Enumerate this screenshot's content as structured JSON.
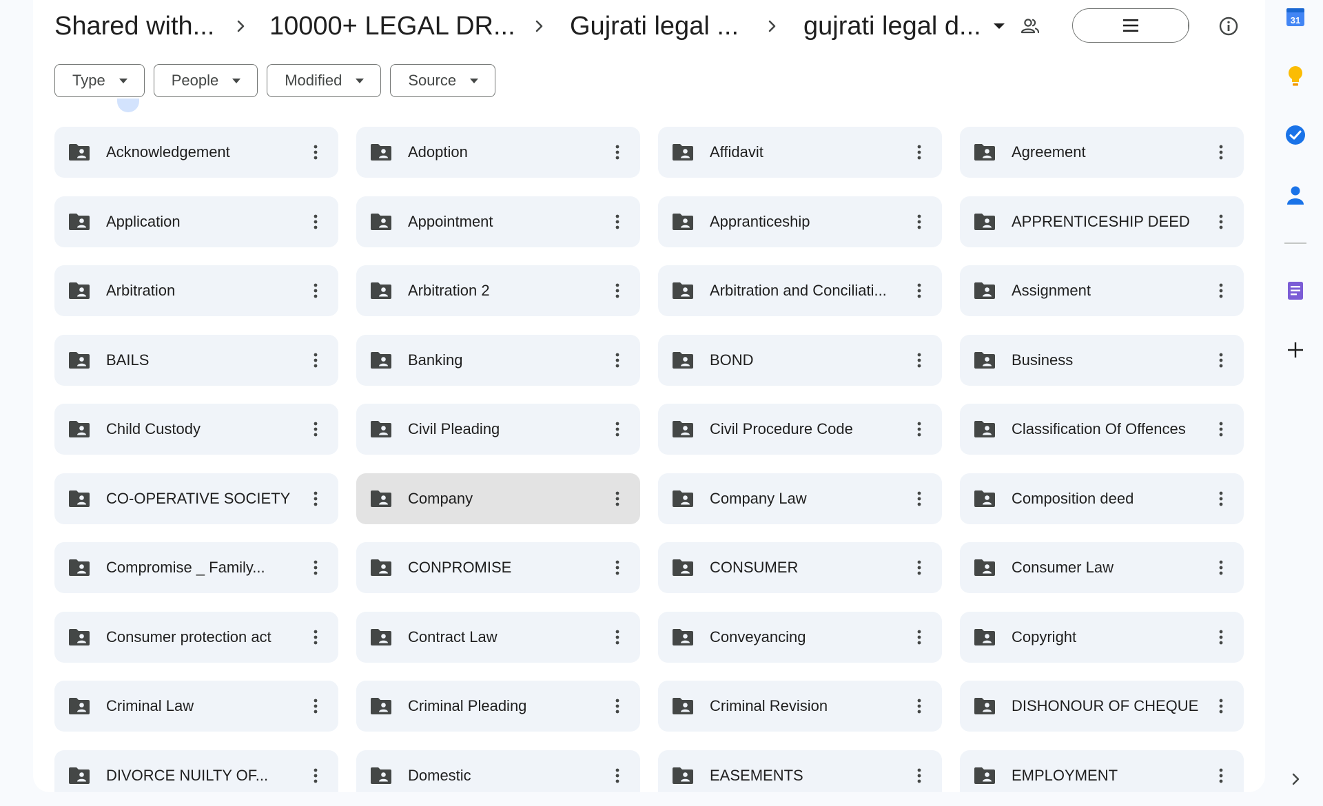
{
  "breadcrumb": {
    "items": [
      {
        "label": "Shared with..."
      },
      {
        "label": "10000+ LEGAL DR..."
      },
      {
        "label": "Gujrati legal ..."
      }
    ],
    "current": "gujrati legal d..."
  },
  "filters": [
    {
      "label": "Type"
    },
    {
      "label": "People"
    },
    {
      "label": "Modified"
    },
    {
      "label": "Source"
    }
  ],
  "folders": [
    {
      "name": "Acknowledgement"
    },
    {
      "name": "Adoption"
    },
    {
      "name": "Affidavit"
    },
    {
      "name": "Agreement"
    },
    {
      "name": "Application"
    },
    {
      "name": "Appointment"
    },
    {
      "name": "Appranticeship"
    },
    {
      "name": "APPRENTICESHIP DEED"
    },
    {
      "name": "Arbitration"
    },
    {
      "name": "Arbitration 2"
    },
    {
      "name": "Arbitration and Conciliati..."
    },
    {
      "name": "Assignment"
    },
    {
      "name": "BAILS"
    },
    {
      "name": "Banking"
    },
    {
      "name": "BOND"
    },
    {
      "name": "Business"
    },
    {
      "name": "Child Custody"
    },
    {
      "name": "Civil Pleading"
    },
    {
      "name": "Civil Procedure Code"
    },
    {
      "name": "Classification Of Offences"
    },
    {
      "name": "CO-OPERATIVE SOCIETY"
    },
    {
      "name": "Company",
      "selected": true
    },
    {
      "name": "Company Law"
    },
    {
      "name": "Composition deed"
    },
    {
      "name": "Compromise _ Family..."
    },
    {
      "name": "CONPROMISE"
    },
    {
      "name": "CONSUMER"
    },
    {
      "name": "Consumer Law"
    },
    {
      "name": "Consumer protection act"
    },
    {
      "name": "Contract Law"
    },
    {
      "name": "Conveyancing"
    },
    {
      "name": "Copyright"
    },
    {
      "name": "Criminal Law"
    },
    {
      "name": "Criminal Pleading"
    },
    {
      "name": "Criminal Revision"
    },
    {
      "name": "DISHONOUR OF CHEQUE"
    },
    {
      "name": "DIVORCE NUILTY OF..."
    },
    {
      "name": "Domestic"
    },
    {
      "name": "EASEMENTS"
    },
    {
      "name": "EMPLOYMENT"
    }
  ],
  "side_rail": {
    "calendar_day": "31",
    "icons": [
      "calendar-icon",
      "keep-icon",
      "tasks-icon",
      "contacts-icon",
      "notes-icon",
      "add-icon",
      "chevron-right-icon"
    ]
  },
  "colors": {
    "page_bg": "#f8fafd",
    "panel_bg": "#ffffff",
    "folder_bg": "#f0f4f9",
    "folder_selected_bg": "#e3e3e3",
    "grid_toggle_bg": "#c2e7ff",
    "text": "#1f1f1f",
    "icon": "#444746"
  }
}
